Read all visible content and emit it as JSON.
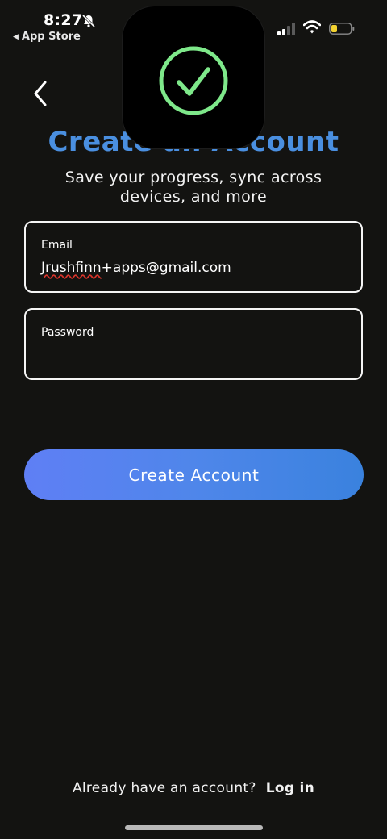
{
  "status_bar": {
    "time": "8:27",
    "back_app": "App Store",
    "battery_color": "#f2d230"
  },
  "icons": {
    "back": "chevron-left-icon",
    "bell": "bell-slash-icon",
    "signal": "cellular-signal-icon",
    "wifi": "wifi-icon",
    "battery": "battery-low-icon",
    "logo": "checkmark-circle-icon"
  },
  "colors": {
    "background": "#131311",
    "title": "#4a8fe0",
    "logo_check": "#7ee88a",
    "button_start": "#5f7ff5",
    "button_end": "#3a82de"
  },
  "header": {
    "title": "Create an Account",
    "subtitle": "Save your progress, sync across devices, and more"
  },
  "form": {
    "email_label": "Email",
    "email_value_spell": "Jrushfinn",
    "email_value_rest": "+apps@gmail.com",
    "password_label": "Password",
    "password_value": ""
  },
  "actions": {
    "create_account": "Create Account"
  },
  "footer": {
    "prompt": "Already have an account?",
    "login_link": "Log in"
  }
}
